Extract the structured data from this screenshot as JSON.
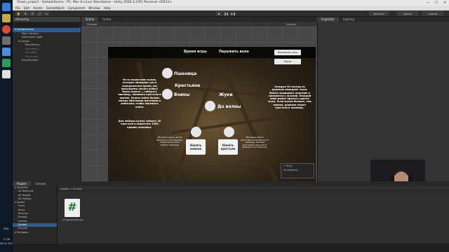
{
  "window": {
    "title": "Clown_project - SampleScene - PC, Mac & Linux Standalone - Unity 2020.3.23f1 Personal <DX11>",
    "controls": [
      "—",
      "☐",
      "✕"
    ]
  },
  "menu": [
    "File",
    "Edit",
    "Assets",
    "GameObject",
    "Component",
    "Window",
    "Help"
  ],
  "toolbar": {
    "account": "Account",
    "layers": "Layers",
    "layout": "Layout"
  },
  "hierarchy": {
    "tab": "Hierarchy",
    "rows": [
      {
        "label": "▾ SampleScene",
        "level": 0,
        "state": "selected"
      },
      {
        "label": "Main Camera",
        "level": 2,
        "state": "normal"
      },
      {
        "label": "Directional Light",
        "level": 2,
        "state": "normal"
      },
      {
        "label": "▾ Canvas",
        "level": 1,
        "state": "normal"
      },
      {
        "label": "PanelScene",
        "level": 3,
        "state": "normal"
      },
      {
        "label": "PanelMenu",
        "level": 3,
        "state": "dim"
      },
      {
        "label": "PanelWin",
        "level": 3,
        "state": "dim"
      },
      {
        "label": "PanelLose",
        "level": 3,
        "state": "dim"
      },
      {
        "label": "EventSystem",
        "level": 2,
        "state": "normal"
      }
    ]
  },
  "scene": {
    "tabs": [
      "Scene",
      "Game"
    ],
    "active_tab": "Scene",
    "shading": "Shaded",
    "gizmos": "Gizmos",
    "overlay_title": "< Persp",
    "overlay_text": "Не найдено ..."
  },
  "game": {
    "time_label": "Время игры",
    "survive_label": "Пережить волн",
    "sound_button": "Выключить звук",
    "pause_button": "Пауза",
    "resources": [
      "Пшеница",
      "Крестьяне",
      "Воины",
      "Жуки",
      "До волны"
    ],
    "left_text": "Из-за нашествия жуков, которые нападают раз в определенное время, мы вынуждены начать войну! Ваша задача — собирать пшеницу, нанимать крестьян и воинов. Нужно найти баланс между обычными жителями и войсками, чтобы пережить атаки.",
    "left_goal": "Для победы нужно собрать 30 крестьян и вырастить 1000 единиц пшеницы.",
    "right_text": "Каждые 30 секунд на деревню нападают жуки. Воины защищают деревню и сражаются с жуками. Каждый воин может одолеть одного жука. Если жуков больше, чем воинов, деревня теряет крестьян и пшеницу.",
    "hire_warriors": "Нанять воинов",
    "hire_peasants": "Нанять крестьян",
    "warrior_note": "Обучение одного воина обходится в 10 пшеницы. Содержание воина требует пшеницы.",
    "peasant_note": "Обучение одного крестьянина обходится в 5 пшеницы. Каждый крестьянин приносит в деревню по 2 пшеницы."
  },
  "inspector": {
    "tabs": [
      "Inspector",
      "Lighting"
    ],
    "active_tab": "Inspector"
  },
  "project": {
    "tabs": [
      "Project",
      "Console"
    ],
    "active_tab": "Project",
    "tree": [
      {
        "label": "▾ Favorites",
        "level": 0
      },
      {
        "label": "All Materials",
        "level": 1
      },
      {
        "label": "All Models",
        "level": 1
      },
      {
        "label": "All Prefabs",
        "level": 1
      },
      {
        "label": "▾ Assets",
        "level": 0
      },
      {
        "label": "Fonts",
        "level": 1
      },
      {
        "label": "Music",
        "level": 1
      },
      {
        "label": "Pictures",
        "level": 1
      },
      {
        "label": "Prefabs",
        "level": 1
      },
      {
        "label": "Scenes",
        "level": 1
      },
      {
        "label": "Scripts",
        "level": 1,
        "selected": true
      },
      {
        "label": "Sounds",
        "level": 1
      },
      {
        "label": "▸ Packages",
        "level": 0
      }
    ],
    "breadcrumb": "Assets > Scripts",
    "asset_name": "ImageUpdateScript"
  },
  "clock": {
    "time": "17:36",
    "date": "08.01.2022",
    "lang": "ENG"
  },
  "colors": {
    "accent_selection": "#2c5d87",
    "script_icon": "#1d7a3a"
  }
}
